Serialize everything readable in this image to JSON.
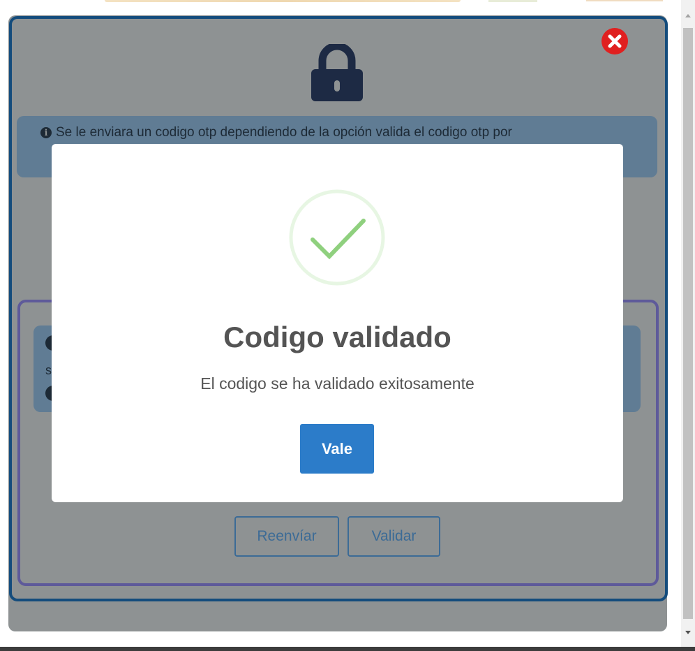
{
  "background_modal": {
    "info_message": "Se le enviara un codigo otp dependiendo de la opción valida el codigo otp por",
    "otp_info_fragment": "s",
    "resend_label": "Reenvíar",
    "validate_label": "Validar"
  },
  "dialog": {
    "icon": "success-check-icon",
    "title": "Codigo validado",
    "message": "El codigo se ha validado exitosamente",
    "confirm_label": "Vale"
  },
  "colors": {
    "overlay_panel": "#8e9293",
    "frame_border": "#144c7c",
    "otp_frame_border": "#5e5a9a",
    "info_box": "#607c94",
    "close_icon": "#e02020",
    "lock_icon": "#1d2a44",
    "success_green": "#8fd07e",
    "confirm_button": "#2c7cc9",
    "dialog_text": "#545454"
  }
}
